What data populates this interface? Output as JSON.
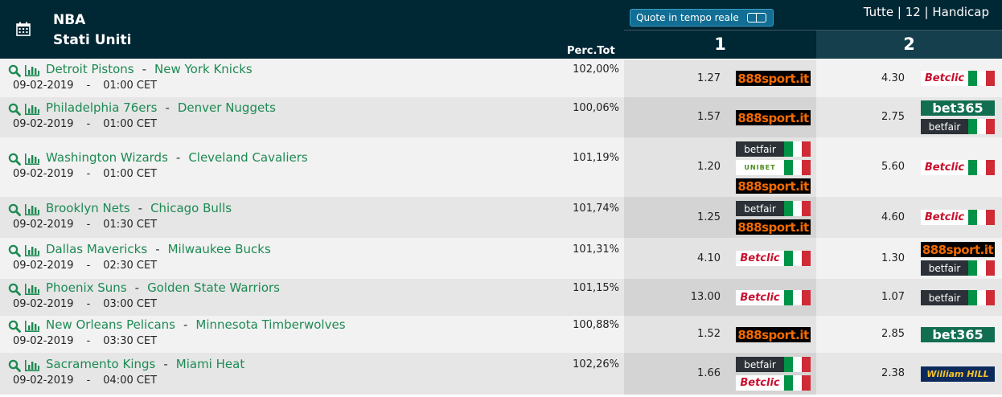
{
  "header": {
    "league": "NBA",
    "country": "Stati Uniti",
    "perc_label": "Perc.Tot",
    "live_label": "Quote in tempo reale",
    "filters": "Tutte | 12 | Handicap",
    "col1": "1",
    "col2": "2"
  },
  "colors": {
    "header_bg": "#002734",
    "team_link": "#1d8a53",
    "live_btn": "#126e94"
  },
  "matches": [
    {
      "home": "Detroit Pistons",
      "away": "New York Knicks",
      "sep": "-",
      "date": "09-02-2019",
      "dsep": "-",
      "time": "01:00 CET",
      "perc": "102,00%",
      "odd1": "1.27",
      "odd2": "4.30",
      "bk1": [
        "888sport.it"
      ],
      "bk2": [
        "Betclic"
      ]
    },
    {
      "home": "Philadelphia 76ers",
      "away": "Denver Nuggets",
      "sep": "-",
      "date": "09-02-2019",
      "dsep": "-",
      "time": "01:00 CET",
      "perc": "100,06%",
      "odd1": "1.57",
      "odd2": "2.75",
      "bk1": [
        "888sport.it"
      ],
      "bk2": [
        "bet365",
        "betfair"
      ]
    },
    {
      "home": "Washington Wizards",
      "away": "Cleveland Cavaliers",
      "sep": "-",
      "date": "09-02-2019",
      "dsep": "-",
      "time": "01:00 CET",
      "perc": "101,19%",
      "odd1": "1.20",
      "odd2": "5.60",
      "bk1": [
        "betfair",
        "UNIBET",
        "888sport.it"
      ],
      "bk2": [
        "Betclic"
      ]
    },
    {
      "home": "Brooklyn Nets",
      "away": "Chicago Bulls",
      "sep": "-",
      "date": "09-02-2019",
      "dsep": "-",
      "time": "01:30 CET",
      "perc": "101,74%",
      "odd1": "1.25",
      "odd2": "4.60",
      "bk1": [
        "betfair",
        "888sport.it"
      ],
      "bk2": [
        "Betclic"
      ]
    },
    {
      "home": "Dallas Mavericks",
      "away": "Milwaukee Bucks",
      "sep": "-",
      "date": "09-02-2019",
      "dsep": "-",
      "time": "02:30 CET",
      "perc": "101,31%",
      "odd1": "4.10",
      "odd2": "1.30",
      "bk1": [
        "Betclic"
      ],
      "bk2": [
        "888sport.it",
        "betfair"
      ]
    },
    {
      "home": "Phoenix Suns",
      "away": "Golden State Warriors",
      "sep": "-",
      "date": "09-02-2019",
      "dsep": "-",
      "time": "03:00 CET",
      "perc": "101,15%",
      "odd1": "13.00",
      "odd2": "1.07",
      "bk1": [
        "Betclic"
      ],
      "bk2": [
        "betfair"
      ]
    },
    {
      "home": "New Orleans Pelicans",
      "away": "Minnesota Timberwolves",
      "sep": "-",
      "date": "09-02-2019",
      "dsep": "-",
      "time": "03:30 CET",
      "perc": "100,88%",
      "odd1": "1.52",
      "odd2": "2.85",
      "bk1": [
        "888sport.it"
      ],
      "bk2": [
        "bet365"
      ]
    },
    {
      "home": "Sacramento Kings",
      "away": "Miami Heat",
      "sep": "-",
      "date": "09-02-2019",
      "dsep": "-",
      "time": "04:00 CET",
      "perc": "102,26%",
      "odd1": "1.66",
      "odd2": "2.38",
      "bk1": [
        "betfair",
        "Betclic"
      ],
      "bk2": [
        "William HILL"
      ]
    }
  ]
}
